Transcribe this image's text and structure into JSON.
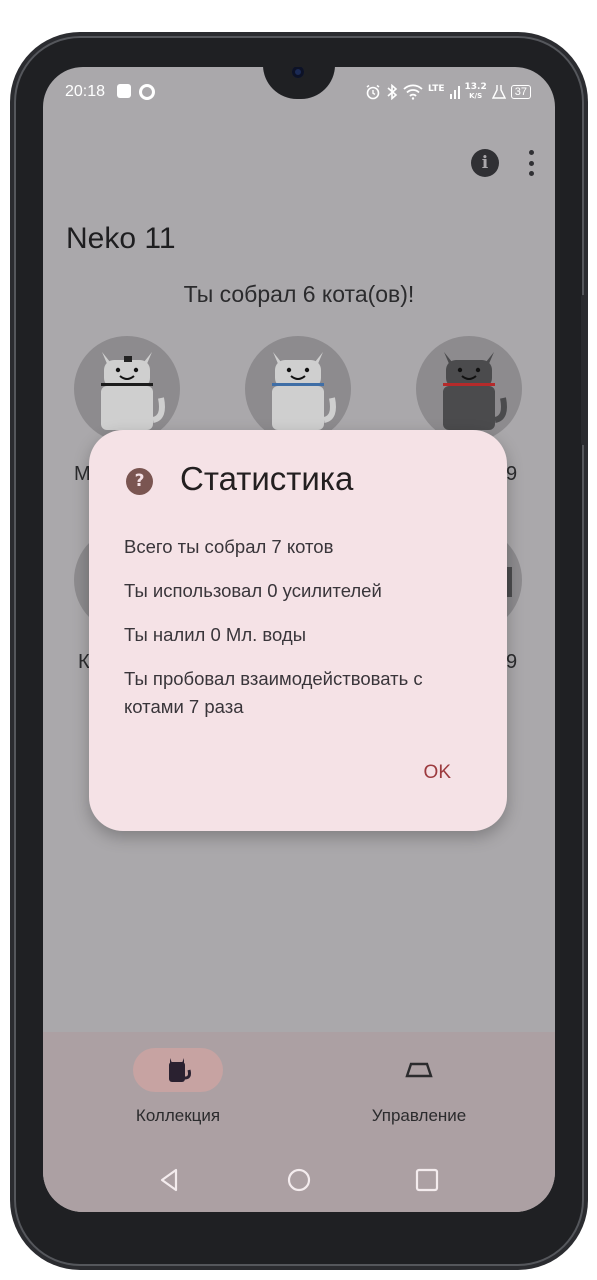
{
  "status_bar": {
    "time": "20:18",
    "left_icons": [
      "notification-app-icon",
      "notification-circle-icon"
    ],
    "right_icons": [
      "alarm-icon",
      "bluetooth-icon",
      "wifi-icon",
      "lte-signal-icon",
      "data-speed-icon",
      "flask-icon"
    ],
    "data_speed": "13.2",
    "data_speed_unit": "K/S",
    "lte": "LTE",
    "battery": "37"
  },
  "top_bar": {
    "info_icon": "i",
    "more_icon": "more-vertical-icon"
  },
  "app": {
    "title": "Neko 11",
    "subtitle": "Ты собрал 6 кота(ов)!"
  },
  "cats": [
    {
      "name_visible": "М",
      "collar": "#1c1c1c",
      "fur": "#c9c9c9"
    },
    {
      "name_visible": "",
      "collar": "#3f6ea6",
      "fur": "#c9c9c9"
    },
    {
      "name_visible": "9",
      "collar": "#b52b2b",
      "fur": "#4b4b4d"
    },
    {
      "name_visible": "К",
      "collar": "",
      "fur": ""
    },
    {
      "name_visible": "9",
      "collar": "",
      "fur": ""
    }
  ],
  "dialog": {
    "icon": "?",
    "title": "Статистика",
    "lines": [
      "Всего ты собрал 7 котов",
      "Ты использовал 0 усилителей",
      "Ты налил 0 Мл. воды",
      "Ты пробовал взаимодействовать с котами 7 раза"
    ],
    "ok_label": "OK"
  },
  "bottom_nav": {
    "items": [
      {
        "label": "Коллекция",
        "icon": "cat-icon",
        "selected": true
      },
      {
        "label": "Управление",
        "icon": "food-bowl-icon",
        "selected": false
      }
    ]
  },
  "system_nav": [
    "back-icon",
    "home-icon",
    "recents-icon"
  ],
  "colors": {
    "dialog_bg": "#f5e2e6",
    "accent": "#9c3a3e",
    "scrim": "#aaa8ab"
  }
}
